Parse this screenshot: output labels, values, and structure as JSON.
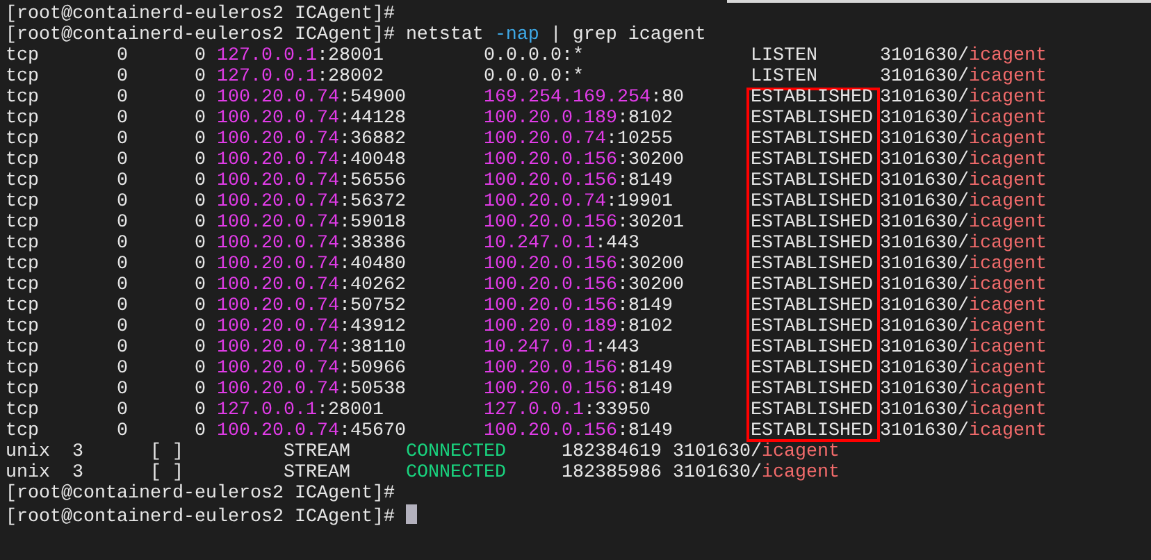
{
  "terminal": {
    "lines": [
      {
        "kind": "prompt",
        "prompt": "[root@containerd-euleros2 ICAgent]#"
      },
      {
        "kind": "prompt",
        "prompt": "[root@containerd-euleros2 ICAgent]#",
        "command": {
          "program": "netstat",
          "option": "-nap",
          "pipe": "| grep icagent"
        }
      },
      {
        "kind": "tcp",
        "proto": "tcp",
        "recv_q": "0",
        "send_q": "0",
        "local_ip": "127.0.0.1",
        "local_port": ":28001",
        "foreign_ip": "0.0.0.0",
        "foreign_port": ":*",
        "foreign_highlighted": false,
        "state": "LISTEN",
        "boxed": false,
        "pid": "3101630/",
        "program": "icagent"
      },
      {
        "kind": "tcp",
        "proto": "tcp",
        "recv_q": "0",
        "send_q": "0",
        "local_ip": "127.0.0.1",
        "local_port": ":28002",
        "foreign_ip": "0.0.0.0",
        "foreign_port": ":*",
        "foreign_highlighted": false,
        "state": "LISTEN",
        "boxed": false,
        "pid": "3101630/",
        "program": "icagent"
      },
      {
        "kind": "tcp",
        "proto": "tcp",
        "recv_q": "0",
        "send_q": "0",
        "local_ip": "100.20.0.74",
        "local_port": ":54900",
        "foreign_ip": "169.254.169.254",
        "foreign_port": ":80",
        "foreign_highlighted": true,
        "state": "ESTABLISHED",
        "boxed": true,
        "pid": "3101630/",
        "program": "icagent"
      },
      {
        "kind": "tcp",
        "proto": "tcp",
        "recv_q": "0",
        "send_q": "0",
        "local_ip": "100.20.0.74",
        "local_port": ":44128",
        "foreign_ip": "100.20.0.189",
        "foreign_port": ":8102",
        "foreign_highlighted": true,
        "state": "ESTABLISHED",
        "boxed": true,
        "pid": "3101630/",
        "program": "icagent"
      },
      {
        "kind": "tcp",
        "proto": "tcp",
        "recv_q": "0",
        "send_q": "0",
        "local_ip": "100.20.0.74",
        "local_port": ":36882",
        "foreign_ip": "100.20.0.74",
        "foreign_port": ":10255",
        "foreign_highlighted": true,
        "state": "ESTABLISHED",
        "boxed": true,
        "pid": "3101630/",
        "program": "icagent"
      },
      {
        "kind": "tcp",
        "proto": "tcp",
        "recv_q": "0",
        "send_q": "0",
        "local_ip": "100.20.0.74",
        "local_port": ":40048",
        "foreign_ip": "100.20.0.156",
        "foreign_port": ":30200",
        "foreign_highlighted": true,
        "state": "ESTABLISHED",
        "boxed": true,
        "pid": "3101630/",
        "program": "icagent"
      },
      {
        "kind": "tcp",
        "proto": "tcp",
        "recv_q": "0",
        "send_q": "0",
        "local_ip": "100.20.0.74",
        "local_port": ":56556",
        "foreign_ip": "100.20.0.156",
        "foreign_port": ":8149",
        "foreign_highlighted": true,
        "state": "ESTABLISHED",
        "boxed": true,
        "pid": "3101630/",
        "program": "icagent"
      },
      {
        "kind": "tcp",
        "proto": "tcp",
        "recv_q": "0",
        "send_q": "0",
        "local_ip": "100.20.0.74",
        "local_port": ":56372",
        "foreign_ip": "100.20.0.74",
        "foreign_port": ":19901",
        "foreign_highlighted": true,
        "state": "ESTABLISHED",
        "boxed": true,
        "pid": "3101630/",
        "program": "icagent"
      },
      {
        "kind": "tcp",
        "proto": "tcp",
        "recv_q": "0",
        "send_q": "0",
        "local_ip": "100.20.0.74",
        "local_port": ":59018",
        "foreign_ip": "100.20.0.156",
        "foreign_port": ":30201",
        "foreign_highlighted": true,
        "state": "ESTABLISHED",
        "boxed": true,
        "pid": "3101630/",
        "program": "icagent"
      },
      {
        "kind": "tcp",
        "proto": "tcp",
        "recv_q": "0",
        "send_q": "0",
        "local_ip": "100.20.0.74",
        "local_port": ":38386",
        "foreign_ip": "10.247.0.1",
        "foreign_port": ":443",
        "foreign_highlighted": true,
        "state": "ESTABLISHED",
        "boxed": true,
        "pid": "3101630/",
        "program": "icagent"
      },
      {
        "kind": "tcp",
        "proto": "tcp",
        "recv_q": "0",
        "send_q": "0",
        "local_ip": "100.20.0.74",
        "local_port": ":40480",
        "foreign_ip": "100.20.0.156",
        "foreign_port": ":30200",
        "foreign_highlighted": true,
        "state": "ESTABLISHED",
        "boxed": true,
        "pid": "3101630/",
        "program": "icagent"
      },
      {
        "kind": "tcp",
        "proto": "tcp",
        "recv_q": "0",
        "send_q": "0",
        "local_ip": "100.20.0.74",
        "local_port": ":40262",
        "foreign_ip": "100.20.0.156",
        "foreign_port": ":30200",
        "foreign_highlighted": true,
        "state": "ESTABLISHED",
        "boxed": true,
        "pid": "3101630/",
        "program": "icagent"
      },
      {
        "kind": "tcp",
        "proto": "tcp",
        "recv_q": "0",
        "send_q": "0",
        "local_ip": "100.20.0.74",
        "local_port": ":50752",
        "foreign_ip": "100.20.0.156",
        "foreign_port": ":8149",
        "foreign_highlighted": true,
        "state": "ESTABLISHED",
        "boxed": true,
        "pid": "3101630/",
        "program": "icagent"
      },
      {
        "kind": "tcp",
        "proto": "tcp",
        "recv_q": "0",
        "send_q": "0",
        "local_ip": "100.20.0.74",
        "local_port": ":43912",
        "foreign_ip": "100.20.0.189",
        "foreign_port": ":8102",
        "foreign_highlighted": true,
        "state": "ESTABLISHED",
        "boxed": true,
        "pid": "3101630/",
        "program": "icagent"
      },
      {
        "kind": "tcp",
        "proto": "tcp",
        "recv_q": "0",
        "send_q": "0",
        "local_ip": "100.20.0.74",
        "local_port": ":38110",
        "foreign_ip": "10.247.0.1",
        "foreign_port": ":443",
        "foreign_highlighted": true,
        "state": "ESTABLISHED",
        "boxed": true,
        "pid": "3101630/",
        "program": "icagent"
      },
      {
        "kind": "tcp",
        "proto": "tcp",
        "recv_q": "0",
        "send_q": "0",
        "local_ip": "100.20.0.74",
        "local_port": ":50966",
        "foreign_ip": "100.20.0.156",
        "foreign_port": ":8149",
        "foreign_highlighted": true,
        "state": "ESTABLISHED",
        "boxed": true,
        "pid": "3101630/",
        "program": "icagent"
      },
      {
        "kind": "tcp",
        "proto": "tcp",
        "recv_q": "0",
        "send_q": "0",
        "local_ip": "100.20.0.74",
        "local_port": ":50538",
        "foreign_ip": "100.20.0.156",
        "foreign_port": ":8149",
        "foreign_highlighted": true,
        "state": "ESTABLISHED",
        "boxed": true,
        "pid": "3101630/",
        "program": "icagent"
      },
      {
        "kind": "tcp",
        "proto": "tcp",
        "recv_q": "0",
        "send_q": "0",
        "local_ip": "127.0.0.1",
        "local_port": ":28001",
        "foreign_ip": "127.0.0.1",
        "foreign_port": ":33950",
        "foreign_highlighted": true,
        "state": "ESTABLISHED",
        "boxed": true,
        "pid": "3101630/",
        "program": "icagent"
      },
      {
        "kind": "tcp",
        "proto": "tcp",
        "recv_q": "0",
        "send_q": "0",
        "local_ip": "100.20.0.74",
        "local_port": ":45670",
        "foreign_ip": "100.20.0.156",
        "foreign_port": ":8149",
        "foreign_highlighted": true,
        "state": "ESTABLISHED",
        "boxed": true,
        "pid": "3101630/",
        "program": "icagent"
      },
      {
        "kind": "unix",
        "proto": "unix",
        "refcnt": "3",
        "flags": "[ ]",
        "type": "STREAM",
        "state": "CONNECTED",
        "inode": "182384619",
        "pid": "3101630/",
        "program": "icagent"
      },
      {
        "kind": "unix",
        "proto": "unix",
        "refcnt": "3",
        "flags": "[ ]",
        "type": "STREAM",
        "state": "CONNECTED",
        "inode": "182385986",
        "pid": "3101630/",
        "program": "icagent"
      },
      {
        "kind": "prompt",
        "prompt": "[root@containerd-euleros2 ICAgent]#"
      },
      {
        "kind": "prompt",
        "prompt": "[root@containerd-euleros2 ICAgent]#",
        "cursor": true
      }
    ]
  }
}
